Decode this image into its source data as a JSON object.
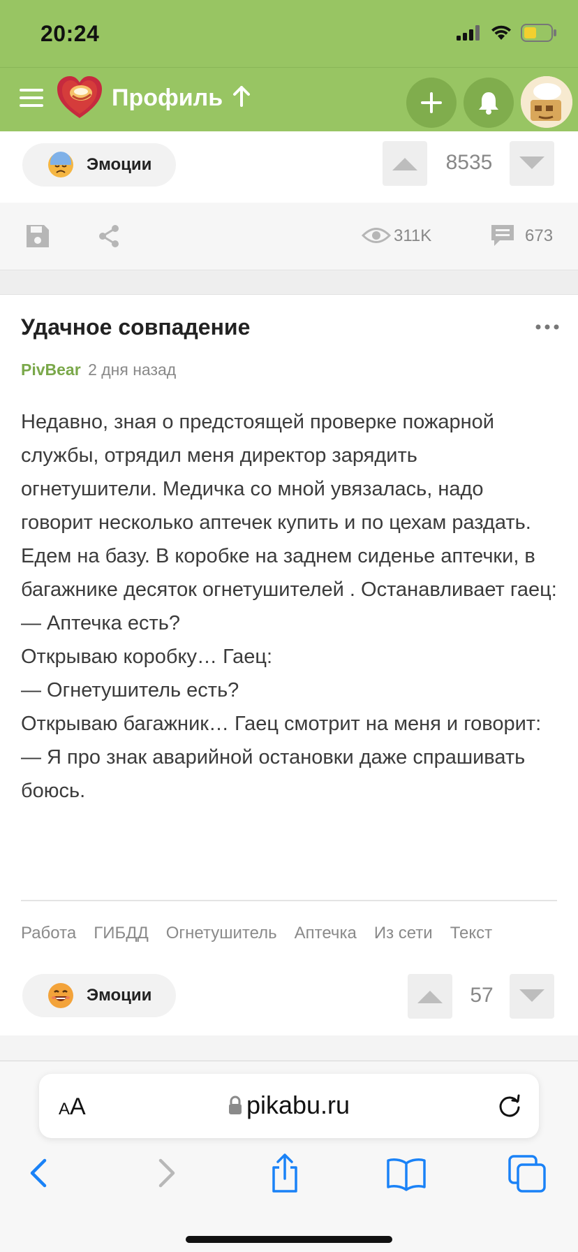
{
  "status_bar": {
    "time": "20:24"
  },
  "nav": {
    "title": "Профиль",
    "icons": [
      "menu-icon",
      "pikabu-logo-icon",
      "arrow-up-icon",
      "plus-icon",
      "bell-icon",
      "avatar"
    ]
  },
  "prev_post": {
    "emotion_label": "Эмоции",
    "rating": "8535",
    "views": "311K",
    "comments": "673"
  },
  "post": {
    "title": "Удачное совпадение",
    "author": "PivBear",
    "time": "2 дня назад",
    "body": [
      "Недавно, зная о предстоящей проверке пожарной службы, отрядил меня директор зарядить огнетушители. Медичка со мной увязалась, надо говорит несколько аптечек купить и по цехам раздать. Едем на базу. В коробке на заднем сиденье аптечки, в багажнике десяток огнетушителей . Останавливает гаец:",
      "— Аптечка есть?",
      "Открываю коробку… Гаец:",
      "— Огнетушитель есть?",
      "Открываю багажник… Гаец смотрит на меня и говорит:",
      "— Я про знак аварийной остановки даже спрашивать боюсь."
    ],
    "tags": [
      "Работа",
      "ГИБДД",
      "Огнетушитель",
      "Аптечка",
      "Из сети",
      "Текст"
    ],
    "emotion_label": "Эмоции",
    "rating": "57"
  },
  "browser": {
    "aa_label_small": "A",
    "aa_label_big": "A",
    "url": "pikabu.ru"
  },
  "colors": {
    "brand_green": "#98c563",
    "author_green": "#7aa84a",
    "ios_blue": "#1a82f7"
  }
}
